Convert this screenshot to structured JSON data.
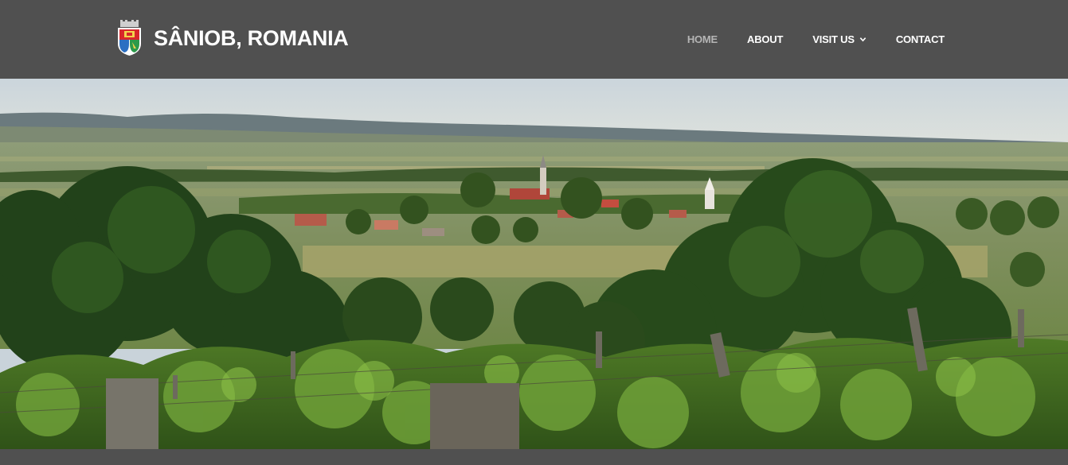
{
  "header": {
    "site_title": "SÂNIOB, ROMANIA",
    "logo_icon": "coat-of-arms-icon"
  },
  "nav": {
    "items": [
      {
        "label": "HOME",
        "active": true
      },
      {
        "label": "ABOUT",
        "active": false
      },
      {
        "label": "VISIT US",
        "active": false,
        "has_dropdown": true,
        "icon": "chevron-down-icon"
      },
      {
        "label": "CONTACT",
        "active": false
      }
    ]
  },
  "colors": {
    "header_bg": "#505050",
    "nav_text": "#ffffff",
    "nav_active": "#b5b5b5"
  },
  "hero": {
    "image_subject": "landscape-village-vineyard"
  }
}
